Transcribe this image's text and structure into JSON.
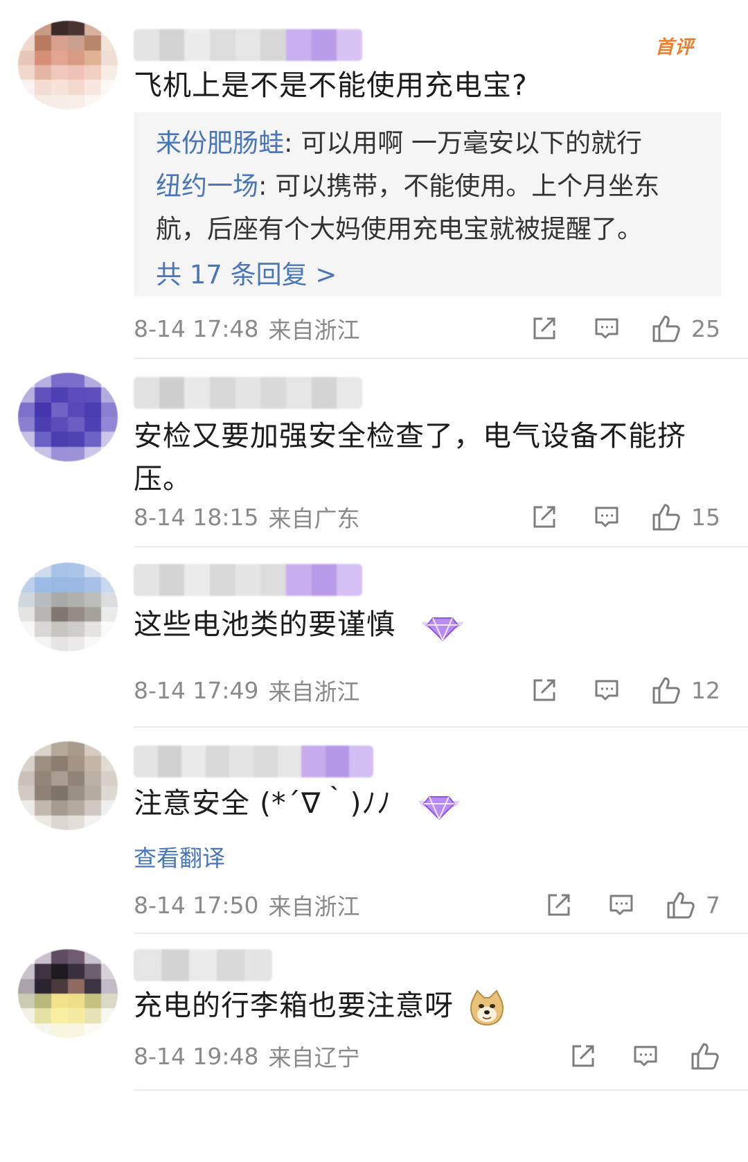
{
  "colors": {
    "link": "#4a76b8",
    "meta": "#8a8a8a",
    "badge": "#f07e2b"
  },
  "comments": [
    {
      "badge": "首评",
      "text": "飞机上是不是不能使用充电宝?",
      "replies": [
        {
          "author": "来份肥肠蛙",
          "sep": ": ",
          "text": "可以用啊 一万毫安以下的就行"
        },
        {
          "author": "纽约一场",
          "sep": ": ",
          "text": "可以携带，不能使用。上个月坐东航，后座有个大妈使用充电宝就被提醒了。"
        }
      ],
      "more_replies": "共 17 条回复 >",
      "time": "8-14 17:48",
      "location": "来自浙江",
      "likes": "25"
    },
    {
      "text": "安检又要加强安全检查了，电气设备不能挤压。",
      "time": "8-14 18:15",
      "location": "来自广东",
      "likes": "15"
    },
    {
      "text": "这些电池类的要谨慎",
      "time": "8-14 17:49",
      "location": "来自浙江",
      "likes": "12"
    },
    {
      "text": "注意安全 (*´∇｀)ﾉﾉ",
      "translate": "查看翻译",
      "time": "8-14 17:50",
      "location": "来自浙江",
      "likes": "7"
    },
    {
      "text": "充电的行李箱也要注意呀",
      "emoji": "doge-emoji",
      "time": "8-14 19:48",
      "location": "来自辽宁",
      "likes": ""
    }
  ]
}
